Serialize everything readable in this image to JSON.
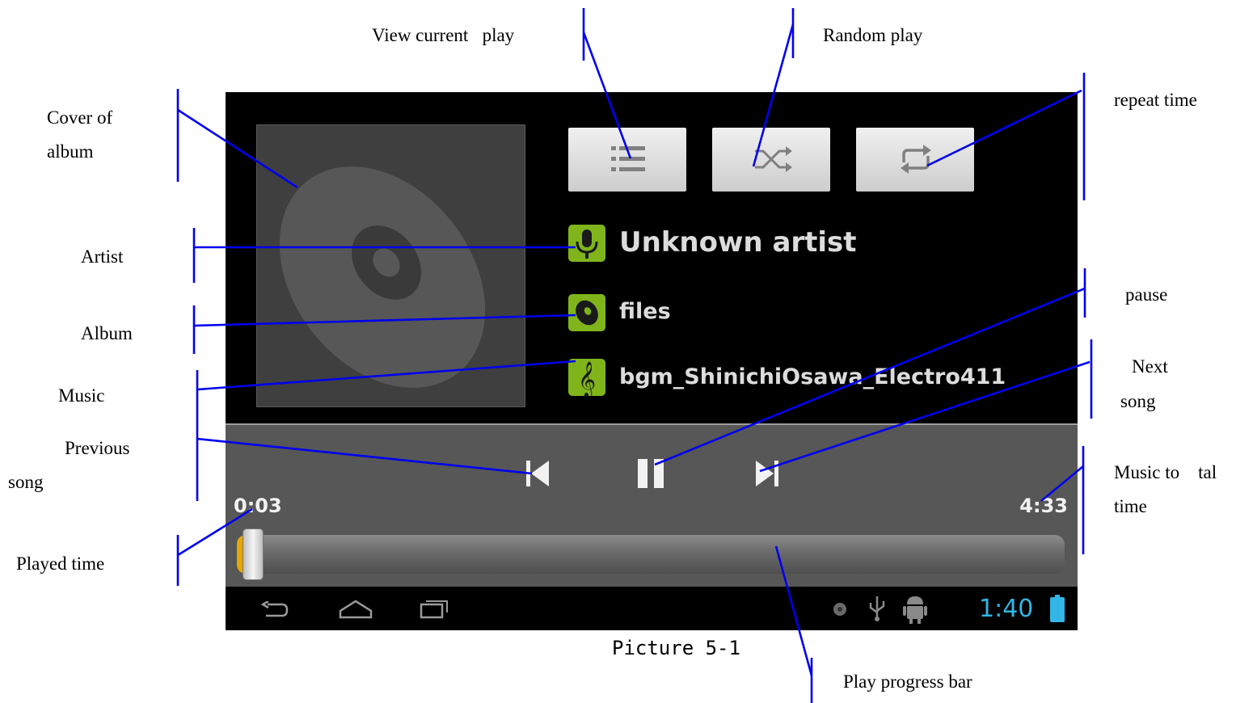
{
  "labels": {
    "view_current_play": "View current   play",
    "random_play": "Random play",
    "repeat_time": "repeat time",
    "cover_of": "Cover of",
    "album_cover_2": "album",
    "artist": "Artist",
    "album": "Album",
    "music": "Music",
    "pause": "pause",
    "next": "Next",
    "next_song": "song",
    "previous": "Previous",
    "previous_song": "song",
    "music_total_1": "Music to    tal",
    "music_total_2": "time",
    "played_time": "Played time",
    "play_progress_bar": "Play progress bar"
  },
  "player": {
    "artist": "Unknown artist",
    "album": "files",
    "track": "bgm_ShinichiOsawa_Electro411",
    "elapsed": "0:03",
    "total": "4:33",
    "progress": 0.011,
    "clock": "1:40"
  },
  "caption": "Picture 5-1",
  "colors": {
    "annotation_line": "#0000ee",
    "icon_green": "#7fb51a",
    "clock_blue": "#33b5e5",
    "progress_fill": "#e5a700"
  },
  "icons": [
    "list-icon",
    "shuffle-icon",
    "repeat-icon",
    "microphone-icon",
    "disc-icon",
    "music-note-icon",
    "previous-icon",
    "pause-icon",
    "next-icon",
    "back-icon",
    "home-icon",
    "recent-apps-icon",
    "media-icon",
    "usb-icon",
    "android-debug-icon",
    "battery-icon"
  ]
}
